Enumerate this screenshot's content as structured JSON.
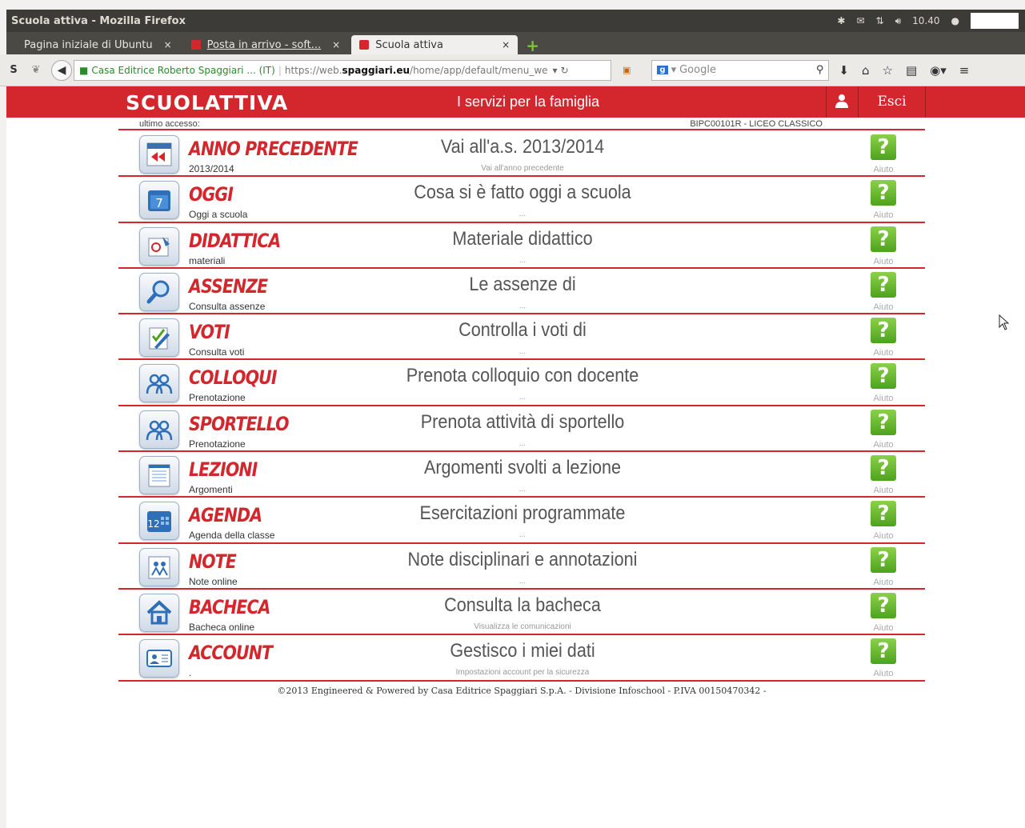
{
  "os": {
    "window_title": "Scuola attiva - Mozilla Firefox",
    "clock": "10.40"
  },
  "browser": {
    "tabs": [
      {
        "label": "Pagina iniziale di Ubuntu"
      },
      {
        "label": "Posta in arrivo - soft..."
      },
      {
        "label": "Scuola attiva"
      }
    ],
    "site_identity": "Casa Editrice Roberto Spaggiari ... (IT)",
    "url_prefix": "https://web.",
    "url_domain": "spaggiari.eu",
    "url_path": "/home/app/default/menu_we",
    "search_placeholder": "Google"
  },
  "header": {
    "logo": "SCUOLATTIVA",
    "tagline": "I servizi per la famiglia",
    "logout": "Esci",
    "last_access_label": "ultimo accesso:",
    "school": "BIPC00101R - LICEO CLASSICO"
  },
  "menu": [
    {
      "title": "ANNO PRECEDENTE",
      "sub": "2013/2014",
      "desc": "Vai all'a.s. 2013/2014",
      "hint": "Vai all'anno precedente",
      "help": "Aiuto",
      "icon": "calendar-back-icon"
    },
    {
      "title": "OGGI",
      "sub": "Oggi a scuola",
      "desc": "Cosa si è fatto oggi a scuola",
      "hint": "...",
      "help": "Aiuto",
      "icon": "calendar-day-icon"
    },
    {
      "title": "DIDATTICA",
      "sub": "materiali",
      "desc": "Materiale didattico",
      "hint": "...",
      "help": "Aiuto",
      "icon": "materials-icon"
    },
    {
      "title": "ASSENZE",
      "sub": "Consulta assenze",
      "desc": "Le assenze di",
      "hint": "...",
      "help": "Aiuto",
      "icon": "magnifier-icon"
    },
    {
      "title": "VOTI",
      "sub": "Consulta voti",
      "desc": "Controlla i voti di",
      "hint": "...",
      "help": "Aiuto",
      "icon": "grades-icon"
    },
    {
      "title": "COLLOQUI",
      "sub": "Prenotazione",
      "desc": "Prenota colloquio con docente",
      "hint": "...",
      "help": "Aiuto",
      "icon": "people-icon"
    },
    {
      "title": "SPORTELLO",
      "sub": "Prenotazione",
      "desc": "Prenota attività di sportello",
      "hint": "...",
      "help": "Aiuto",
      "icon": "people-icon"
    },
    {
      "title": "LEZIONI",
      "sub": "Argomenti",
      "desc": "Argomenti svolti a lezione",
      "hint": "...",
      "help": "Aiuto",
      "icon": "notepad-icon"
    },
    {
      "title": "AGENDA",
      "sub": "Agenda della classe",
      "desc": "Esercitazioni programmate",
      "hint": "...",
      "help": "Aiuto",
      "icon": "agenda-icon"
    },
    {
      "title": "NOTE",
      "sub": "Note online",
      "desc": "Note disciplinari e annotazioni",
      "hint": "...",
      "help": "Aiuto",
      "icon": "notes-icon"
    },
    {
      "title": "BACHECA",
      "sub": "Bacheca online",
      "desc": "Consulta la bacheca",
      "hint": "Visualizza le comunicazioni",
      "help": "Aiuto",
      "icon": "home-icon"
    },
    {
      "title": "ACCOUNT",
      "sub": ".",
      "desc": "Gestisco i miei dati",
      "hint": "Impostazioni account per la sicurezza",
      "help": "Aiuto",
      "icon": "id-card-icon"
    }
  ],
  "footer": "©2013 Engineered & Powered by Casa Editrice Spaggiari S.p.A. - Divisione Infoschool - P.IVA 00150470342 -",
  "colors": {
    "brand_red": "#d3272d",
    "help_green": "#5fb02b"
  }
}
